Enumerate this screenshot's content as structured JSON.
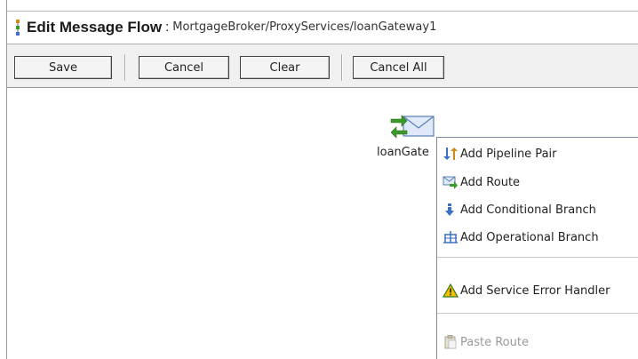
{
  "header": {
    "title": "Edit Message Flow",
    "separator": ":",
    "path": "MortgageBroker/ProxyServices/loanGateway1",
    "icon": "flow-icon"
  },
  "toolbar": {
    "save_label": "Save",
    "cancel_label": "Cancel",
    "clear_label": "Clear",
    "cancel_all_label": "Cancel All"
  },
  "node": {
    "label": "loanGate",
    "icon": "proxy-service-envelope-icon"
  },
  "context_menu": {
    "items": [
      {
        "label": "Add Pipeline Pair",
        "icon": "pipeline-pair-icon",
        "enabled": true
      },
      {
        "label": "Add Route",
        "icon": "route-icon",
        "enabled": true
      },
      {
        "label": "Add Conditional Branch",
        "icon": "conditional-branch-icon",
        "enabled": true
      },
      {
        "label": "Add Operational Branch",
        "icon": "operational-branch-icon",
        "enabled": true
      },
      {
        "label": "Add Service Error Handler",
        "icon": "warning-icon",
        "enabled": true
      },
      {
        "label": "Paste Route",
        "icon": "clipboard-icon",
        "enabled": false
      }
    ]
  },
  "colors": {
    "toolbar_bg": "#f0f0f0",
    "menu_border": "#7a8aa0",
    "arrow_green": "#3a9a2a",
    "arrow_blue": "#3d6fc4",
    "warning_yellow": "#f2c200",
    "disabled_text": "#9a9a9a"
  }
}
